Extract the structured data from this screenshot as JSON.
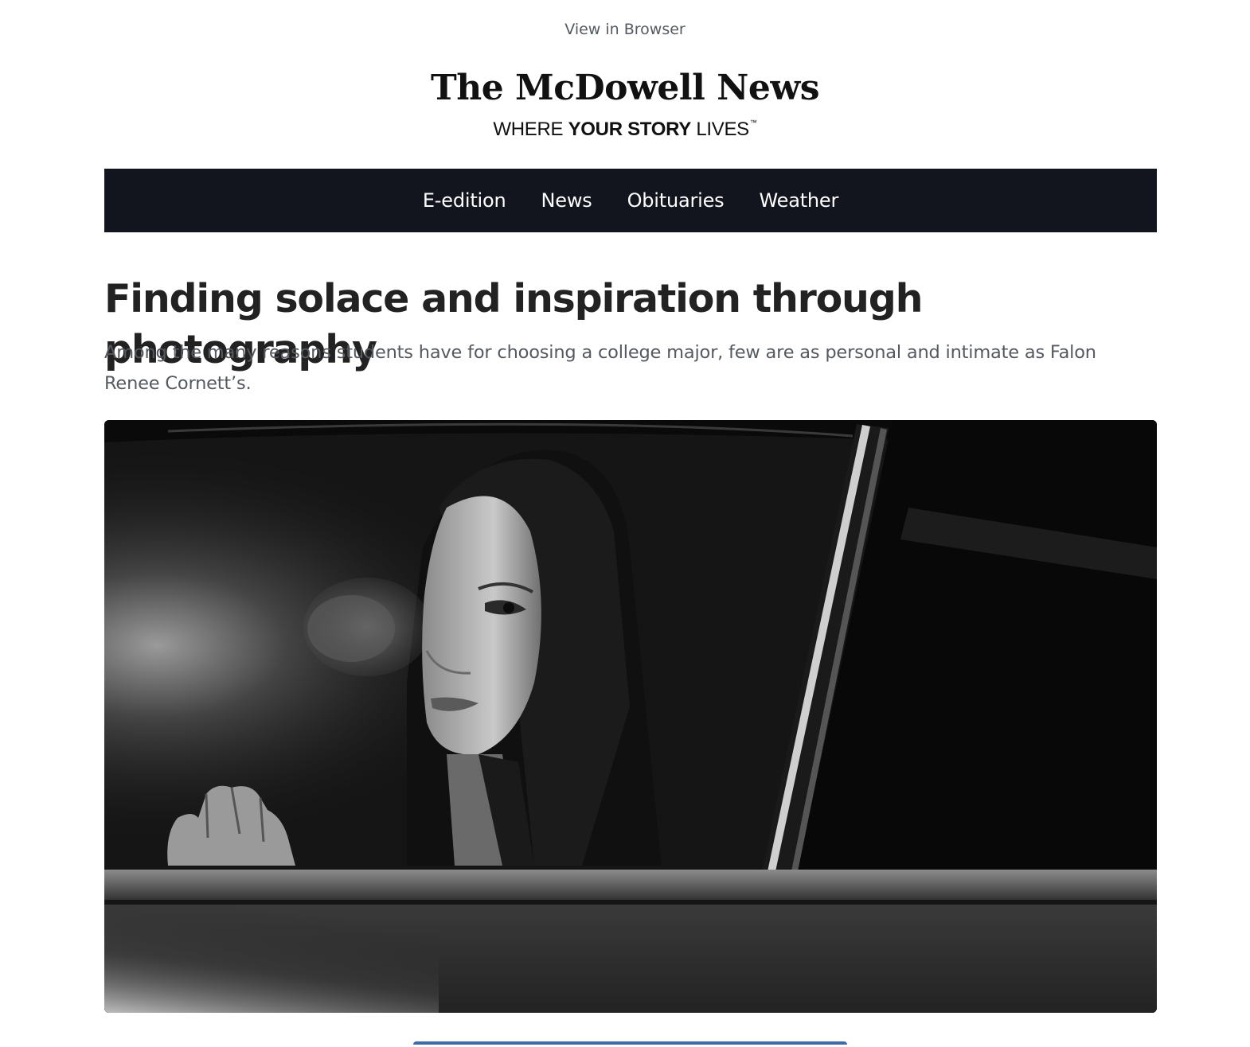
{
  "header": {
    "view_in_browser": "View in Browser"
  },
  "masthead": {
    "name": "The McDowell News",
    "tagline_pre": "WHERE ",
    "tagline_bold": "YOUR STORY",
    "tagline_post": " LIVES",
    "tagline_mark": "™"
  },
  "nav": {
    "items": [
      {
        "label": "E-edition"
      },
      {
        "label": "News"
      },
      {
        "label": "Obituaries"
      },
      {
        "label": "Weather"
      }
    ]
  },
  "article": {
    "headline": "Finding solace and inspiration through photography",
    "dek": "Among the many reasons students have for choosing a college major, few are as personal and intimate as Falon Renee Cornett’s."
  },
  "colors": {
    "nav_background": "#12151d",
    "text_dark": "#222222",
    "text_muted": "#555a61",
    "button_border": "#3e6aa8"
  },
  "icons": {
    "hero": "photo-woman-in-car-window"
  }
}
